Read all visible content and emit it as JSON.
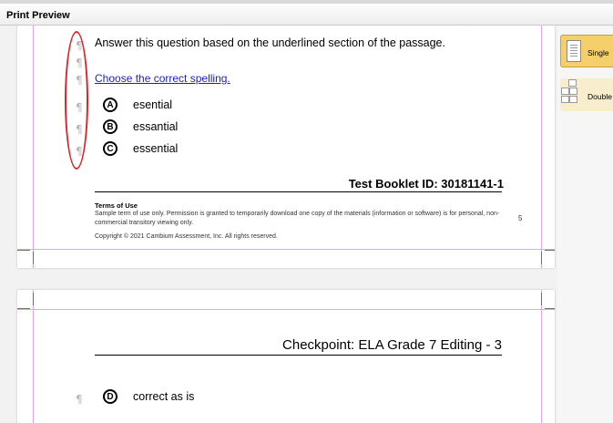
{
  "window": {
    "title": "Print Preview"
  },
  "page1": {
    "question": "Answer this question based on the underlined section of the passage.",
    "prompt_link": "Choose the correct spelling.",
    "options": [
      {
        "letter": "A",
        "text": "esential"
      },
      {
        "letter": "B",
        "text": "essantial"
      },
      {
        "letter": "C",
        "text": "essential"
      }
    ],
    "paragraph_mark": "¶",
    "booklet_id": "Test Booklet ID: 30181141-1",
    "terms_title": "Terms of Use",
    "terms_body": "Sample term of use only. Permission is granted to temporarily download one copy of the materials (information or software) is for personal, non-commercial transitory viewing only.",
    "copyright": "Copyright © 2021 Cambium Assessment, Inc. All rights reserved.",
    "page_number": "5"
  },
  "page2": {
    "header": "Checkpoint: ELA Grade 7 Editing - 3",
    "option": {
      "letter": "D",
      "text": "correct as is"
    },
    "paragraph_mark": "¶"
  },
  "sidebar": {
    "single_label": "Single",
    "double_label": "Double"
  },
  "colors": {
    "selected_view": "#f4cf6a",
    "unselected_view": "#f8edcc",
    "annotation": "#d8262e",
    "guides": "#e0a8e8",
    "link": "#1f1fbf"
  }
}
